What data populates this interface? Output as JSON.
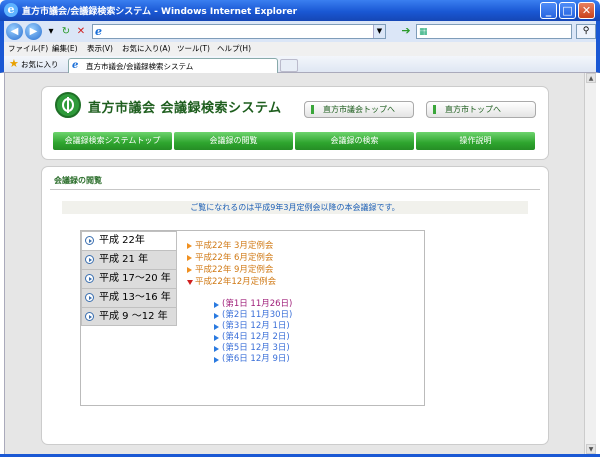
{
  "window": {
    "title": "直方市議会/会議録検索システム - Windows Internet Explorer",
    "minimize": "_",
    "maximize": "□",
    "close": "✕"
  },
  "menu": [
    "ファイル(F)",
    "編集(E)",
    "表示(V)",
    "お気に入り(A)",
    "ツール(T)",
    "ヘルプ(H)"
  ],
  "favorites": {
    "label": "お気に入り",
    "tab_label": "直方市議会/会議録検索システム"
  },
  "site": {
    "title": "直方市議会 会議録検索システム",
    "top_links": [
      "直方市議会トップへ",
      "直方市トップへ"
    ],
    "nav": [
      "会議録検索システムトップ",
      "会議録の閲覧",
      "会議録の検索",
      "操作説明"
    ]
  },
  "main": {
    "section_title": "会議録の閲覧",
    "notice": "ご覧になれるのは平成9年3月定例会以降の本会議録です。",
    "years": [
      "平成 22年",
      "平成 21 年",
      "平成 17～20 年",
      "平成 13～16 年",
      "平成 9 ～12 年"
    ],
    "active_year_index": 0,
    "sessions": [
      {
        "label": "平成22年 3月定例会",
        "open": false
      },
      {
        "label": "平成22年 6月定例会",
        "open": false
      },
      {
        "label": "平成22年 9月定例会",
        "open": false
      },
      {
        "label": "平成22年12月定例会",
        "open": true
      }
    ],
    "days": [
      {
        "label": "(第1日 11月26日)",
        "visited": true
      },
      {
        "label": "(第2日 11月30日)",
        "visited": false
      },
      {
        "label": "(第3日 12月 1日)",
        "visited": false
      },
      {
        "label": "(第4日 12月 2日)",
        "visited": false
      },
      {
        "label": "(第5日 12月 3日)",
        "visited": false
      },
      {
        "label": "(第6日 12月 9日)",
        "visited": false
      }
    ]
  },
  "colors": {
    "accent_green": "#2ea52e",
    "title_green": "#1e5e1e",
    "link_blue": "#3a6fd8",
    "visited": "#a0207a",
    "session_orange": "#d07a16"
  }
}
